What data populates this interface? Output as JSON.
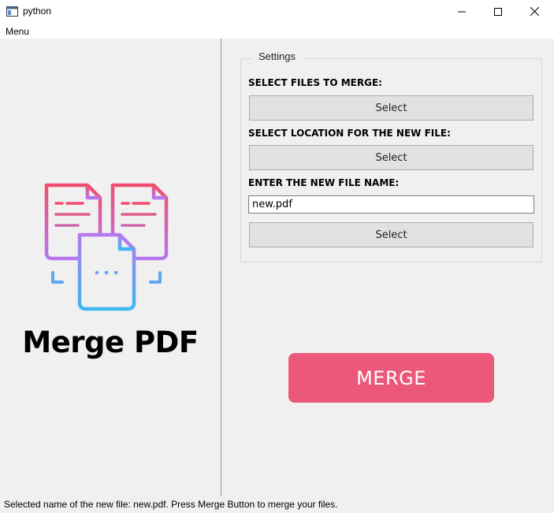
{
  "window": {
    "title": "python",
    "app_icon": "python-window-icon",
    "controls": [
      "minimize-icon",
      "maximize-icon",
      "close-icon"
    ]
  },
  "menubar": {
    "items": [
      "Menu"
    ]
  },
  "logo": {
    "text": "Merge PDF",
    "icon": "merge-documents-icon"
  },
  "settings": {
    "title": "Settings",
    "select_files_label": "SELECT FILES TO MERGE:",
    "select_files_button": "Select",
    "select_location_label": "SELECT LOCATION FOR THE NEW FILE:",
    "select_location_button": "Select",
    "file_name_label": "ENTER THE NEW FILE NAME:",
    "file_name_value": "new.pdf",
    "name_select_button": "Select"
  },
  "merge_button": "MERGE",
  "status": "Selected name of the new file: new.pdf. Press Merge Button to merge your files.",
  "colors": {
    "merge_button": "#ec587a",
    "logo_gradient_top": "#f04e6e",
    "logo_gradient_mid": "#b678f0",
    "logo_gradient_bottom": "#3cb8f0"
  }
}
